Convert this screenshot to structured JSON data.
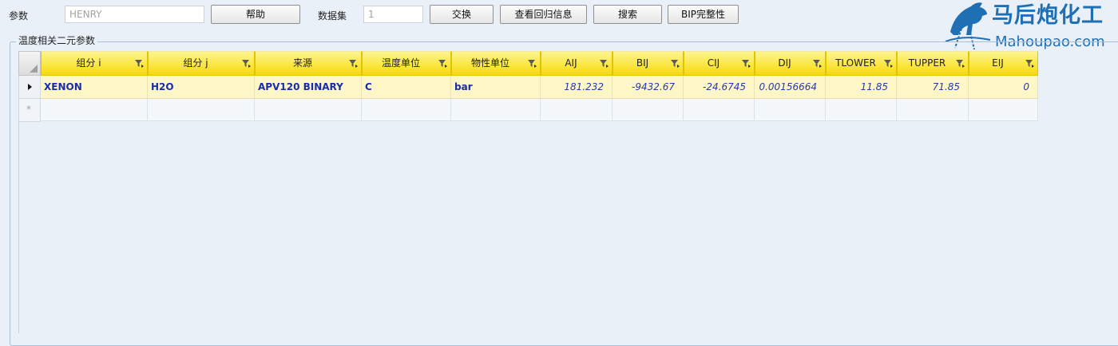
{
  "toolbar": {
    "param_label": "参数",
    "param_value": "HENRY",
    "help_label": "帮助",
    "dataset_label": "数据集",
    "dataset_value": "1",
    "swap_label": "交换",
    "regression_label": "查看回归信息",
    "search_label": "搜索",
    "bip_label": "BIP完整性"
  },
  "logo": {
    "brand_text": "马后炮化工",
    "site_text": "Mahoupao.com",
    "brand_color": "#1f6fb5"
  },
  "group": {
    "title": "温度相关二元参数"
  },
  "table": {
    "columns": [
      "组分 i",
      "组分 j",
      "来源",
      "温度单位",
      "物性单位",
      "AIJ",
      "BIJ",
      "CIJ",
      "DIJ",
      "TLOWER",
      "TUPPER",
      "EIJ"
    ],
    "rows": [
      [
        "XENON",
        "H2O",
        "APV120 BINARY",
        "C",
        "bar",
        "181.232",
        "-9432.67",
        "-24.6745",
        "0.00156664",
        "11.85",
        "71.85",
        "0"
      ]
    ],
    "header_color": "#f9e233",
    "selected_row_color": "#fdf7c8",
    "value_color": "#1a2da8"
  },
  "icons": {
    "current_row": "play-arrow",
    "new_row": "asterisk",
    "column_filter": "funnel-icon"
  }
}
